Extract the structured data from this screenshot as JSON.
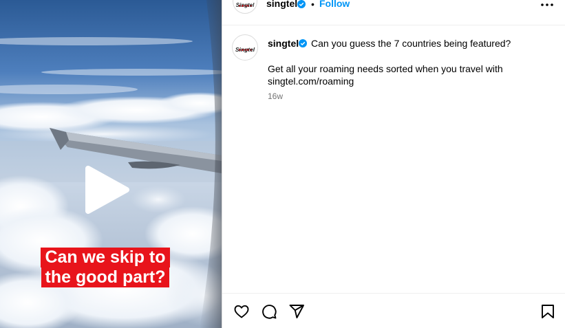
{
  "media": {
    "caption_line1": "Can we skip to",
    "caption_line2": "the good part?",
    "play_icon": "play-icon",
    "colors": {
      "caption_bg": "#e8141b"
    }
  },
  "header": {
    "avatar_logo": "Singtel",
    "username": "singtel",
    "verified_icon": "verified-badge-icon",
    "separator": "•",
    "follow_label": "Follow",
    "more_icon": "more-options-icon"
  },
  "caption": {
    "avatar_logo": "Singtel",
    "username": "singtel",
    "text_line1": "Can you guess the 7 countries being featured?",
    "text_line2": "Get all your roaming needs sorted when you travel with singtel.com/roaming",
    "time": "16w"
  },
  "actions": {
    "icons": [
      "heart-icon",
      "comment-icon",
      "share-icon",
      "bookmark-icon"
    ]
  },
  "colors": {
    "accent": "#0095f6",
    "brand_red": "#e8141b",
    "divider": "#dbdbdb",
    "muted_text": "#737373"
  }
}
